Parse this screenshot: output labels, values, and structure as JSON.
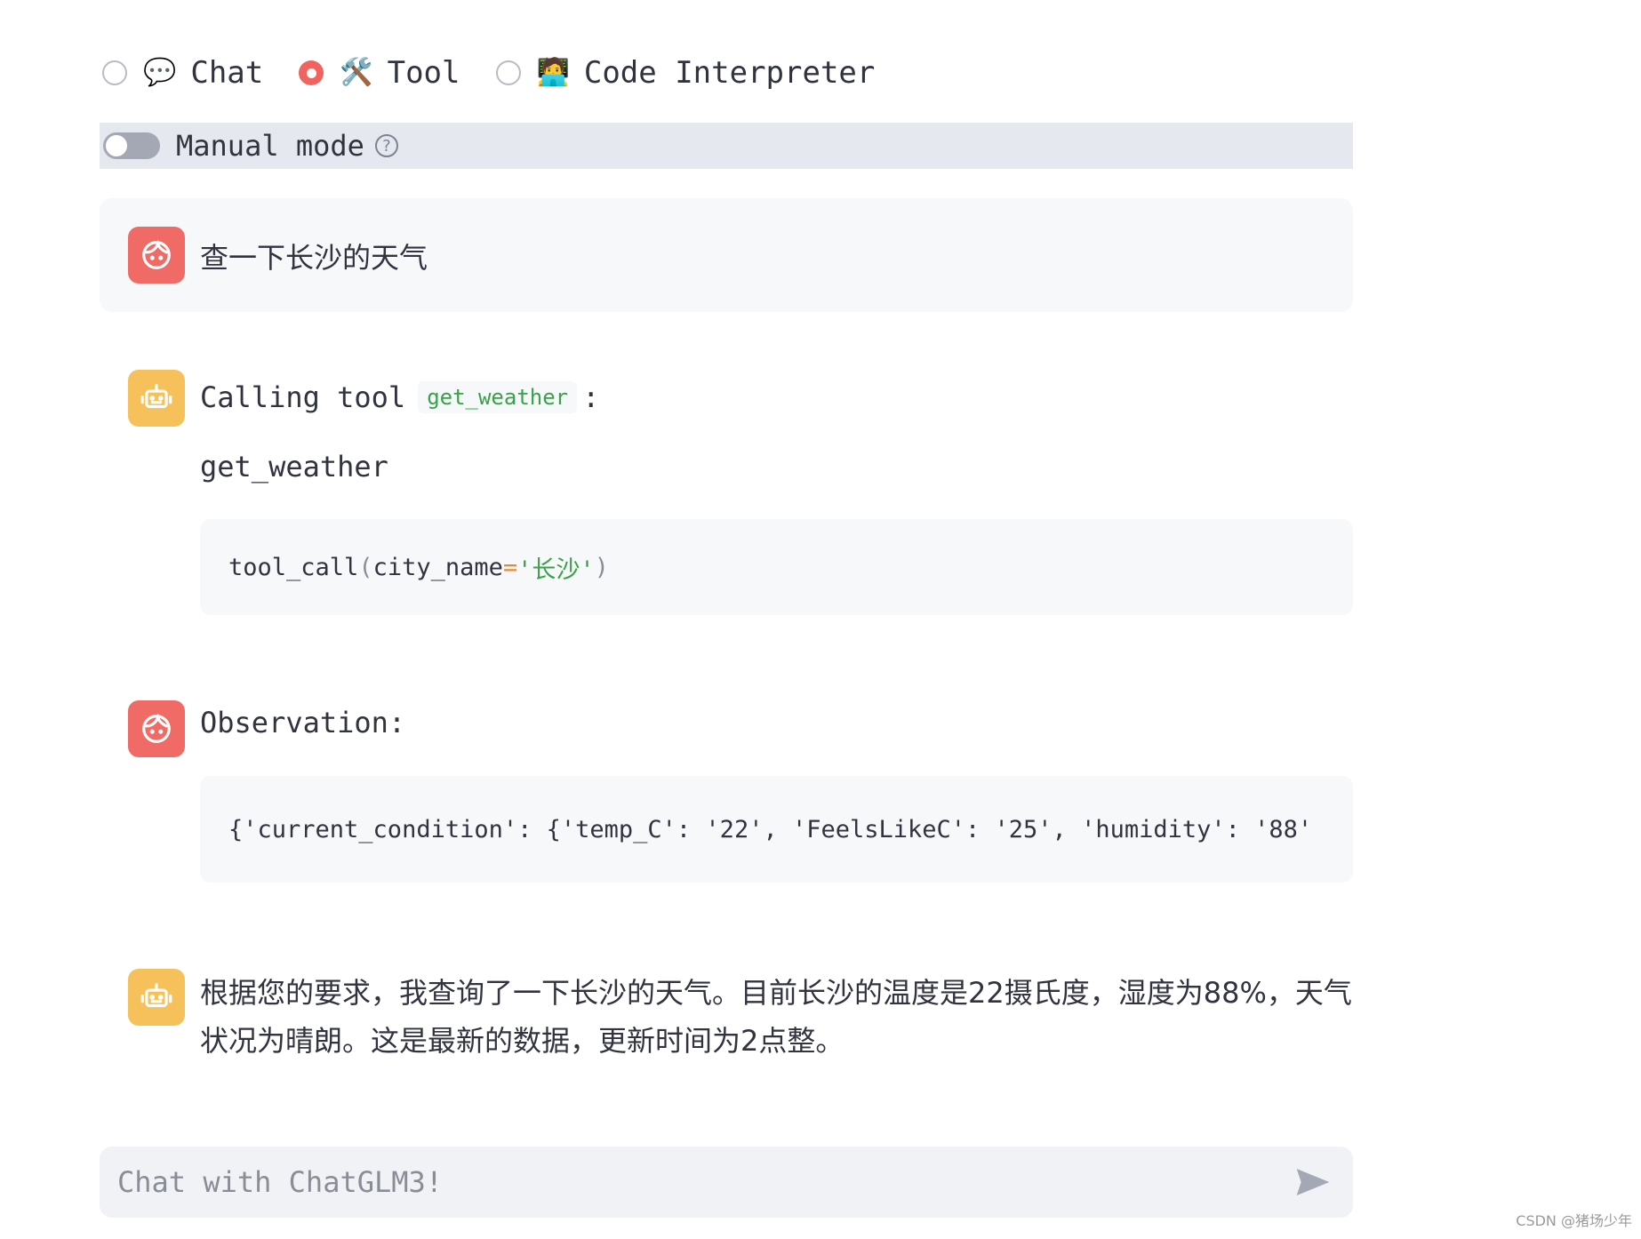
{
  "modes": [
    {
      "icon": "💬",
      "label": "Chat",
      "selected": false
    },
    {
      "icon": "🛠️",
      "label": "Tool",
      "selected": true
    },
    {
      "icon": "🧑‍💻",
      "label": "Code Interpreter",
      "selected": false
    }
  ],
  "manual_mode": {
    "label": "Manual mode",
    "enabled": false,
    "help_symbol": "?"
  },
  "messages": {
    "user_query": {
      "text": "查一下长沙的天气"
    },
    "tool_call": {
      "prefix": "Calling tool",
      "tool_name": "get_weather",
      "suffix": ":",
      "function_name": "get_weather",
      "code": {
        "fn": "tool_call",
        "open": "(",
        "arg": "city_name",
        "eq": "=",
        "value": "'长沙'",
        "close": ")"
      }
    },
    "observation": {
      "label": "Observation:",
      "code": "{'current_condition': {'temp_C': '22', 'FeelsLikeC': '25', 'humidity': '88'"
    },
    "answer": {
      "text": "根据您的要求，我查询了一下长沙的天气。目前长沙的温度是22摄氏度，湿度为88%，天气状况为晴朗。这是最新的数据，更新时间为2点整。"
    }
  },
  "chat_input": {
    "placeholder": "Chat with ChatGLM3!",
    "value": ""
  },
  "watermark": "CSDN @猪场少年",
  "colors": {
    "user_avatar": "#f06b66",
    "bot_avatar": "#f6c05a",
    "radio_selected": "#f0645f",
    "inline_code": "#3aa14a"
  }
}
